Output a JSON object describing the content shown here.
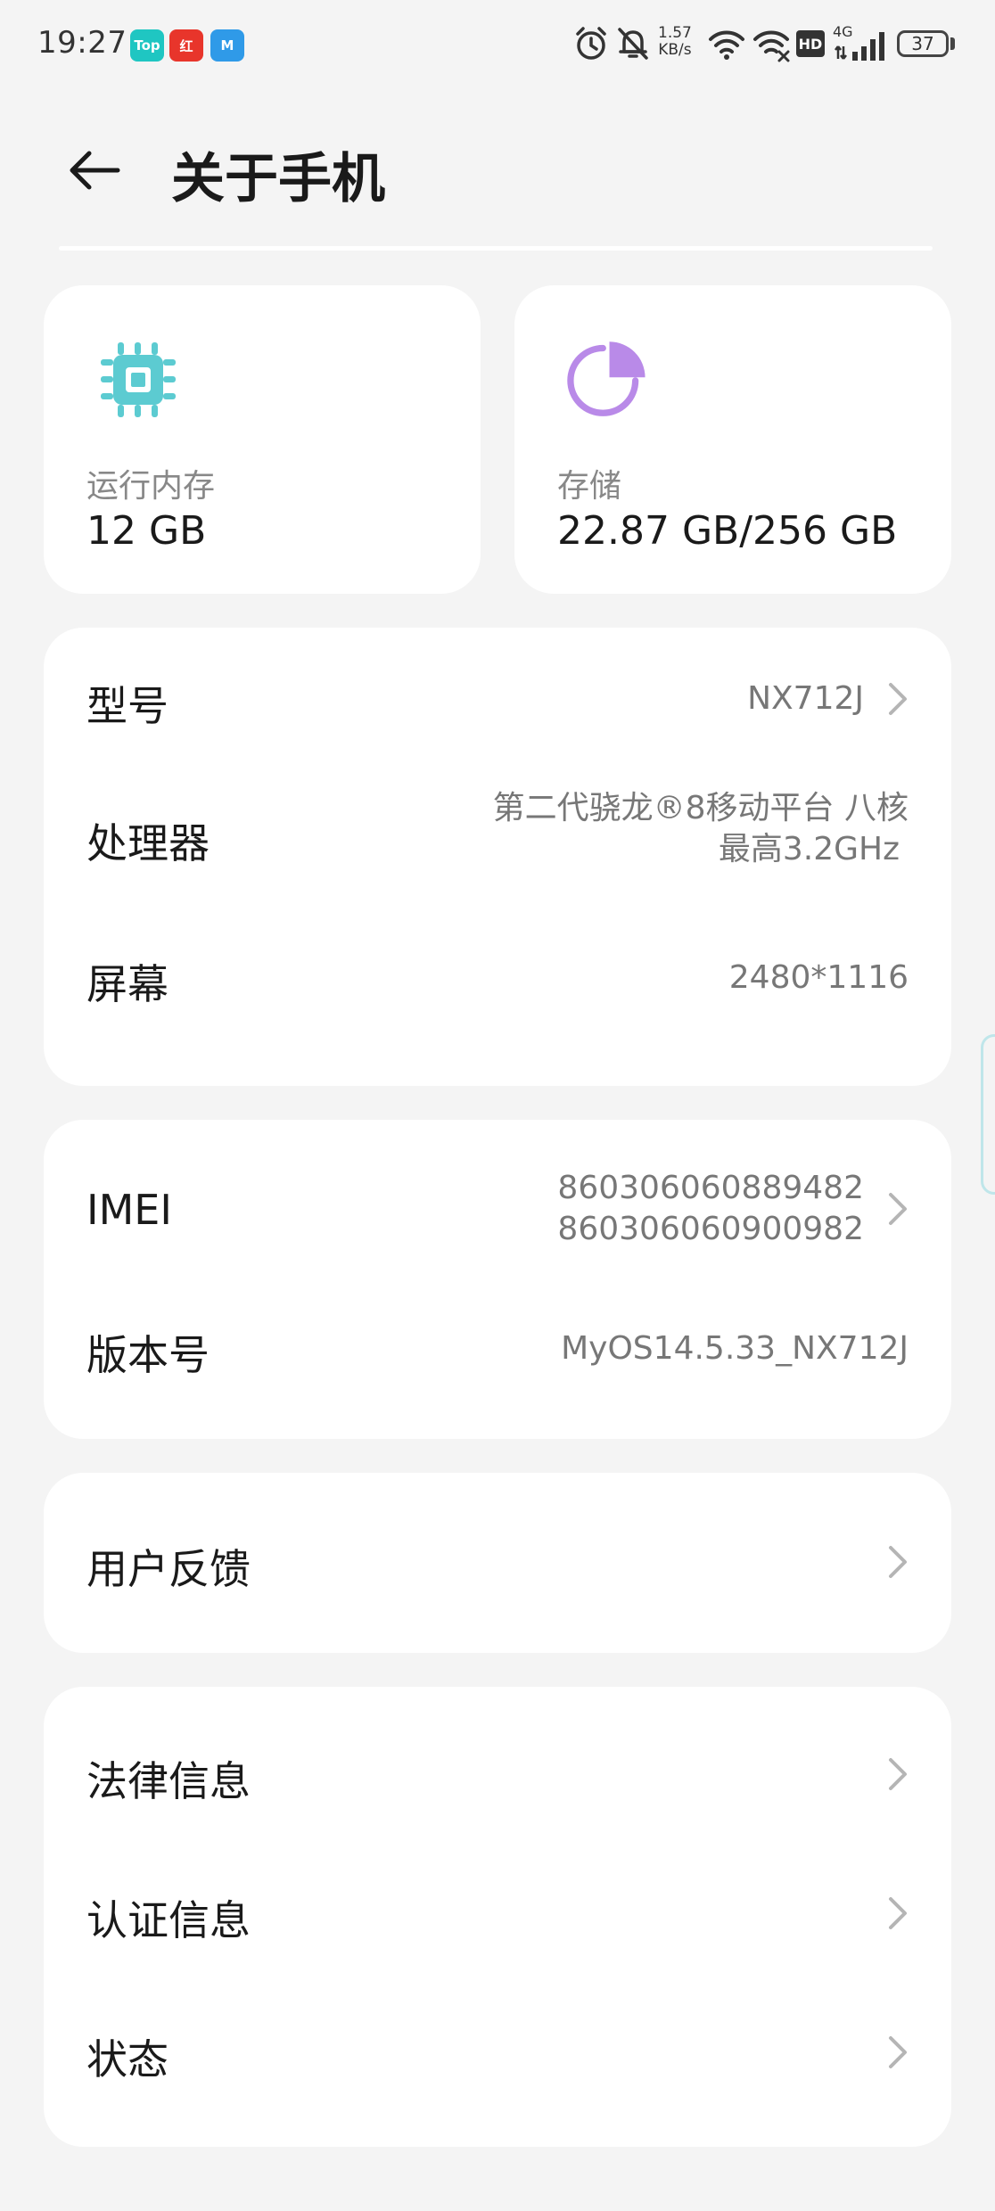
{
  "status_bar": {
    "time": "19:27",
    "app_icons": [
      "Top",
      "红",
      "M"
    ],
    "net_speed_value": "1.57",
    "net_speed_unit": "KB/s",
    "hd": "HD",
    "network": "4G",
    "battery": "37"
  },
  "header": {
    "title": "关于手机"
  },
  "memory": {
    "ram_label": "运行内存",
    "ram_value": "12 GB",
    "storage_label": "存储",
    "storage_value": "22.87 GB/256 GB"
  },
  "device_info": {
    "model_label": "型号",
    "model_value": "NX712J",
    "processor_label": "处理器",
    "processor_line1": "第二代骁龙®8移动平台 八核",
    "processor_line2": "最高3.2GHz",
    "screen_label": "屏幕",
    "screen_value": "2480*1116"
  },
  "identity": {
    "imei_label": "IMEI",
    "imei_1": "860306060889482",
    "imei_2": "860306060900982",
    "version_label": "版本号",
    "version_value": "MyOS14.5.33_NX712J"
  },
  "feedback": {
    "label": "用户反馈"
  },
  "legal": {
    "legal_label": "法律信息",
    "cert_label": "认证信息",
    "status_label": "状态"
  },
  "colors": {
    "ram_icon": "#5ccbd1",
    "storage_icon": "#b98ae8",
    "background": "#f4f4f4",
    "card": "#ffffff"
  }
}
